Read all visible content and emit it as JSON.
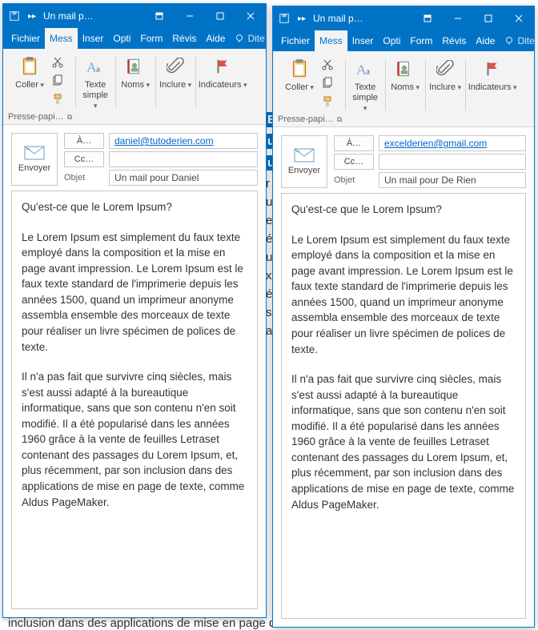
{
  "colors": {
    "primary": "#0173c7"
  },
  "titlebar": {
    "title": "Un mail p…"
  },
  "tabs": {
    "file": "Fichier",
    "message": "Mess",
    "insert": "Inser",
    "options": "Opti",
    "format": "Form",
    "review": "Révis",
    "help": "Aide",
    "tellme": "Dite"
  },
  "ribbon": {
    "clipboard": {
      "paste": "Coller",
      "group": "Presse-papi…"
    },
    "basic_text": {
      "label": "Texte",
      "label2": "simple",
      "drop": true
    },
    "names": {
      "label": "Noms"
    },
    "include": {
      "label": "Inclure"
    },
    "tags": {
      "label": "Indicateurs"
    }
  },
  "send": {
    "label": "Envoyer"
  },
  "fields": {
    "to": "À…",
    "cc": "Cc…",
    "subject": "Objet"
  },
  "window1": {
    "to_value": "daniel@tutoderien.com",
    "cc_value": "",
    "subject_value": "Un mail pour Daniel",
    "body": {
      "p1": "Qu'est-ce que le Lorem Ipsum?",
      "p2": "Le Lorem Ipsum est simplement du faux texte employé dans la composition et la mise en page avant impression. Le Lorem Ipsum est le faux texte standard de l'imprimerie depuis les années 1500, quand un imprimeur anonyme assembla ensemble des morceaux de texte pour réaliser un livre spécimen de polices de texte.",
      "p3": "Il n'a pas fait que survivre cinq siècles, mais s'est aussi adapté à la bureautique informatique, sans que son contenu n'en soit modifié. Il a été popularisé dans les années 1960 grâce à la vente de feuilles Letraset contenant des passages du Lorem Ipsum, et, plus récemment, par son inclusion dans des applications de mise en page de texte, comme Aldus PageMaker."
    }
  },
  "window2": {
    "to_value": "excelderien@gmail.com",
    "cc_value": "",
    "subject_value": "Un mail pour De Rien",
    "body": {
      "p1": "Qu'est-ce que le Lorem Ipsum?",
      "p2": "Le Lorem Ipsum est simplement du faux texte employé dans la composition et la mise en page avant impression. Le Lorem Ipsum est le faux texte standard de l'imprimerie depuis les années 1500, quand un imprimeur anonyme assembla ensemble des morceaux de texte pour réaliser un livre spécimen de polices de texte.",
      "p3": "Il n'a pas fait que survivre cinq siècles, mais s'est aussi adapté à la bureautique informatique, sans que son contenu n'en soit modifié. Il a été popularisé dans les années 1960 grâce à la vente de feuilles Letraset contenant des passages du Lorem Ipsum, et, plus récemment, par son inclusion dans des applications de mise en page de texte, comme Aldus PageMaker."
    }
  },
  "bg": {
    "l1": "E-",
    "l2": "ut",
    "l3": "ut",
    "l4": "r",
    "l5": "ue",
    "l6": "es",
    "l7": "é i",
    "l8": "u ",
    "l9": "x ",
    "l10": "é ",
    "l11": "s ",
    "l12": "a ",
    "bottom": "inclusion dans des applications de mise en page de"
  }
}
